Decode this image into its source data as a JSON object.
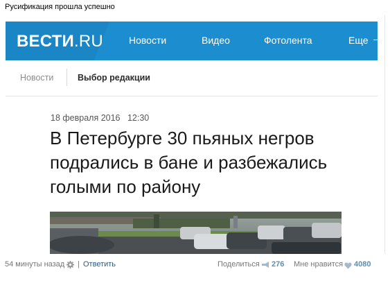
{
  "post": {
    "text": "Русификация прошла успешно"
  },
  "site": {
    "logo_bold": "ВЕСТИ",
    "logo_thin": ".RU",
    "nav": [
      "Новости",
      "Видео",
      "Фотолента",
      "Еще"
    ],
    "breadcrumbs": [
      "Новости",
      "Выбор редакции"
    ],
    "article": {
      "date": "18 февраля 2016",
      "time": "12:30",
      "title": "В Петербурге 30 пьяных негров подрались в бане и разбежались голыми по району"
    },
    "colors": {
      "header": "#1c8ed0"
    }
  },
  "footer": {
    "time_ago": "54 минуты назад",
    "reply": "Ответить",
    "share_label": "Поделиться",
    "share_count": "276",
    "like_label": "Мне нравится",
    "like_count": "4080",
    "icons": [
      "gear-icon",
      "megaphone-icon",
      "heart-icon"
    ]
  }
}
